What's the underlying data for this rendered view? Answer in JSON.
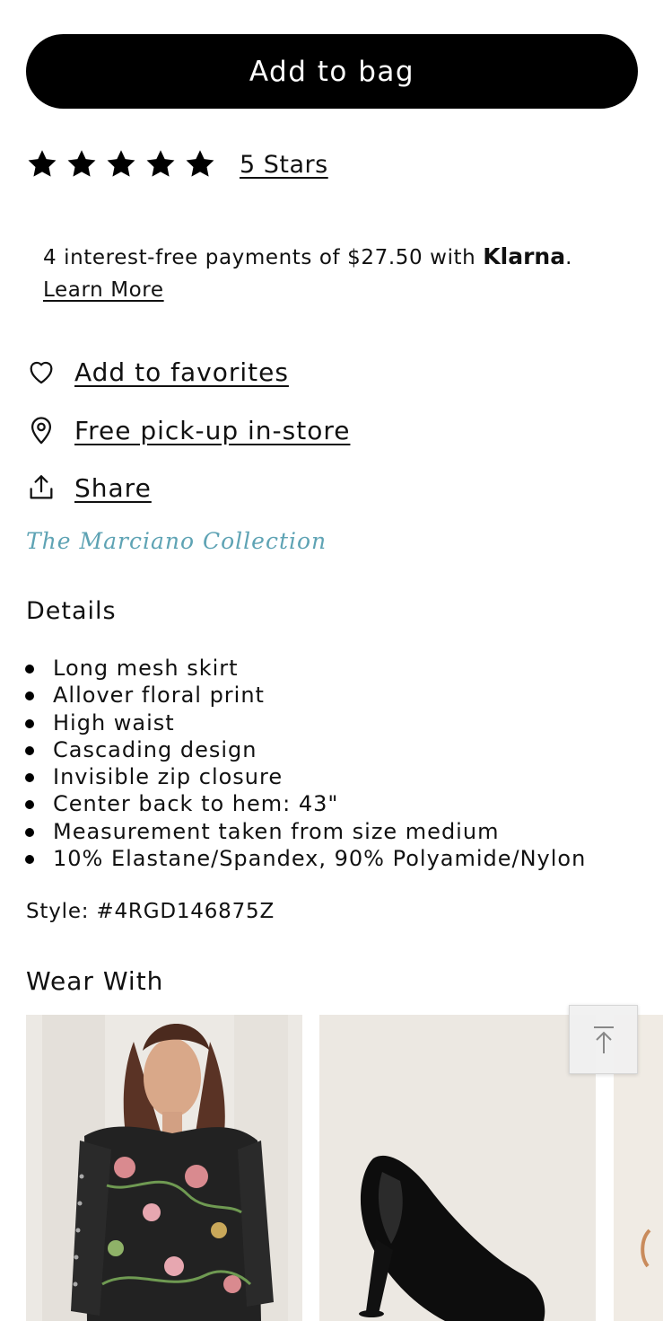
{
  "add_to_bag": {
    "label": "Add to bag"
  },
  "rating": {
    "stars": 5,
    "max_stars": 5,
    "label": "5 Stars",
    "icon": "star-icon"
  },
  "klarna": {
    "prefix": "4 interest-free payments of $27.50 with ",
    "brand": "Klarna",
    "suffix": ".",
    "learn_more": "Learn More"
  },
  "actions": {
    "favorites": {
      "label": "Add to favorites",
      "icon": "heart-icon"
    },
    "pickup": {
      "label": "Free pick-up in-store",
      "icon": "location-pin-icon"
    },
    "share": {
      "label": "Share",
      "icon": "share-icon"
    }
  },
  "collection": {
    "label": "The Marciano Collection",
    "color": "#5ea3b4"
  },
  "details": {
    "title": "Details",
    "items": [
      "Long mesh skirt",
      "Allover floral print",
      "High waist",
      "Cascading design",
      "Invisible zip closure",
      "Center back to hem: 43\"",
      "Measurement taken from size medium",
      "10% Elastane/Spandex, 90% Polyamide/Nylon"
    ]
  },
  "style": {
    "text": "Style: #4RGD146875Z"
  },
  "wear_with": {
    "title": "Wear With"
  },
  "scroll_top": {
    "icon": "arrow-up-to-top-icon"
  }
}
